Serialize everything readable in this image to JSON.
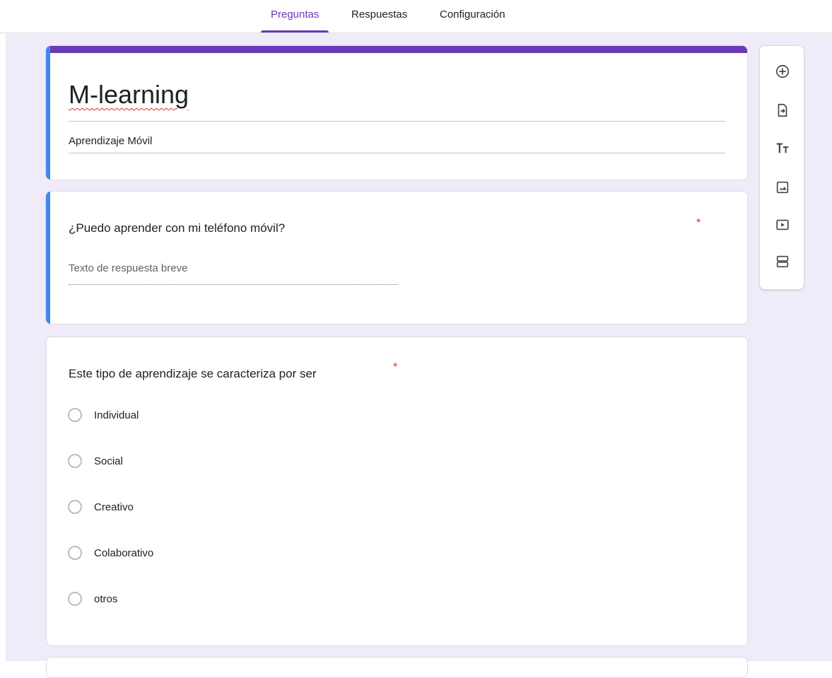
{
  "tabs": [
    {
      "label": "Preguntas",
      "active": true
    },
    {
      "label": "Respuestas",
      "active": false
    },
    {
      "label": "Configuración",
      "active": false
    }
  ],
  "form": {
    "title": "M-learning",
    "description": "Aprendizaje Móvil"
  },
  "questions": [
    {
      "title": "¿Puedo aprender con mi teléfono móvil?",
      "required": "*",
      "answer_placeholder": "Texto de respuesta breve"
    },
    {
      "title": "Este tipo de aprendizaje se caracteriza por ser",
      "required": "*",
      "options": [
        "Individual",
        "Social",
        "Creativo",
        "Colaborativo",
        "otros"
      ]
    }
  ],
  "toolbar": {
    "icons": [
      "add-question-icon",
      "import-questions-icon",
      "add-title-icon",
      "add-image-icon",
      "add-video-icon",
      "add-section-icon"
    ]
  },
  "colors": {
    "accent": "#673ab7",
    "selected_card": "#4285f4",
    "background": "#f0ebf8",
    "required": "#d93025"
  }
}
